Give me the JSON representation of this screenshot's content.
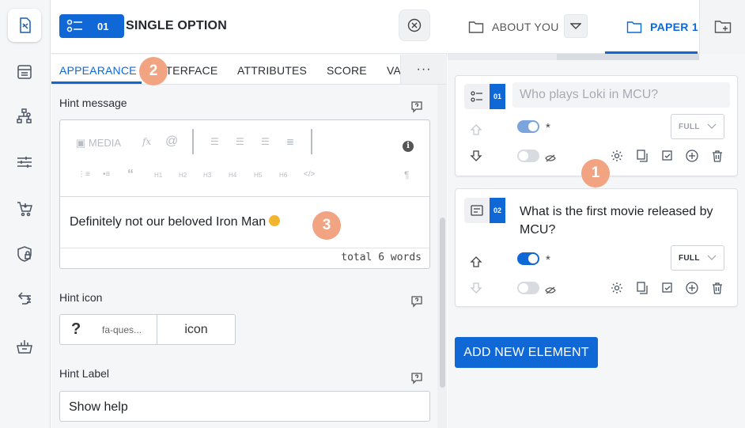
{
  "rail": {
    "items": [
      {
        "icon": "edit-document-icon",
        "active": true
      },
      {
        "icon": "list-form-icon",
        "active": false
      },
      {
        "icon": "logic-tree-icon",
        "active": false
      },
      {
        "icon": "sliders-icon",
        "active": false
      },
      {
        "icon": "cart-icon",
        "active": false
      },
      {
        "icon": "shield-lock-icon",
        "active": false
      },
      {
        "icon": "integration-icon",
        "active": false
      },
      {
        "icon": "basket-icon",
        "active": false
      }
    ]
  },
  "element_panel": {
    "badge_number": "01",
    "title": "SINGLE OPTION",
    "tabs": [
      "APPEARANCE",
      "INTERFACE",
      "ATTRIBUTES",
      "SCORE",
      "VA"
    ],
    "more": "···",
    "hint_message": {
      "label": "Hint message",
      "toolbar_media": "MEDIA",
      "toolbar_fx": "fx",
      "toolbar_at": "@",
      "toolbar_h": [
        "H1",
        "H2",
        "H3",
        "H4",
        "H5",
        "H6"
      ],
      "toolbar_quote": "“",
      "toolbar_code": "</>",
      "toolbar_para": "¶",
      "content": "Definitely not our beloved Iron Man",
      "word_count": "total 6 words"
    },
    "hint_icon": {
      "label": "Hint icon",
      "symbol": "?",
      "value": "fa-ques...",
      "button": "icon"
    },
    "hint_label": {
      "label": "Hint Label",
      "value": "Show help"
    }
  },
  "pages": {
    "tabs": [
      {
        "label": "ABOUT YOU",
        "active": false
      },
      {
        "label": "PAPER 1",
        "active": true
      }
    ]
  },
  "questions": [
    {
      "number": "01",
      "placeholder": "Who plays Loki in MCU?",
      "text": "",
      "required_on": true,
      "visible_on": false,
      "width_label": "FULL"
    },
    {
      "number": "02",
      "placeholder": "",
      "text": "What is the first movie released by MCU?",
      "required_on": true,
      "visible_on": false,
      "width_label": "FULL"
    }
  ],
  "required_marker": "*",
  "add_element_label": "ADD NEW ELEMENT",
  "callouts": [
    "1",
    "2",
    "3"
  ],
  "colors": {
    "accent": "#1068d6",
    "callout": "#f2a382"
  }
}
